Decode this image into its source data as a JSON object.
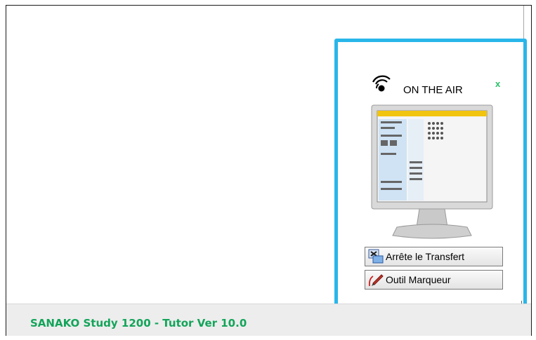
{
  "panel": {
    "onair_label": "ON THE AIR",
    "close_glyph": "x",
    "buttons": [
      {
        "label": "Arrête le Transfert",
        "icon": "stop-transfer-icon"
      },
      {
        "label": "Outil Marqueur",
        "icon": "marker-pen-icon"
      }
    ],
    "accent_color": "#29b6e9"
  },
  "status_bar": {
    "text": "SANAKO Study 1200 - Tutor  Ver 10.0",
    "color": "#13a45a"
  }
}
